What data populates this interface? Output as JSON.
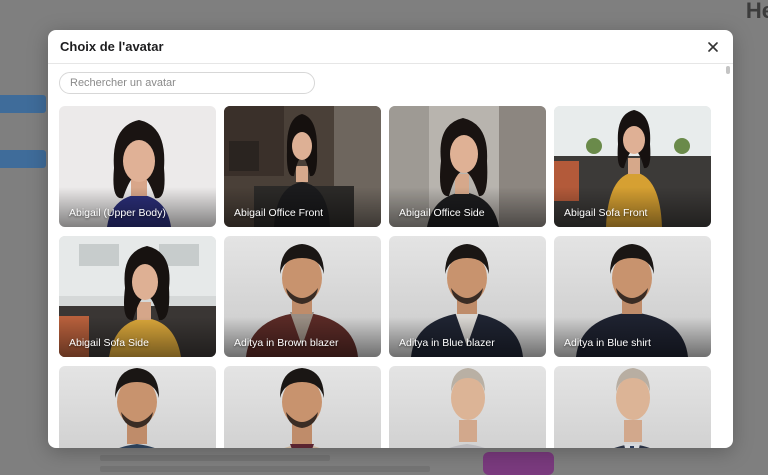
{
  "modal": {
    "title": "Choix de l'avatar",
    "search_placeholder": "Rechercher un avatar"
  },
  "avatars": [
    {
      "label": "Abigail (Upper Body)"
    },
    {
      "label": "Abigail Office Front"
    },
    {
      "label": "Abigail Office Side"
    },
    {
      "label": "Abigail Sofa Front"
    },
    {
      "label": "Abigail Sofa Side"
    },
    {
      "label": "Aditya in Brown blazer"
    },
    {
      "label": "Aditya in Blue blazer"
    },
    {
      "label": "Aditya in Blue shirt"
    },
    {
      "label": ""
    },
    {
      "label": ""
    },
    {
      "label": ""
    },
    {
      "label": ""
    }
  ],
  "colors": {
    "accent": "#7a3a7e"
  }
}
